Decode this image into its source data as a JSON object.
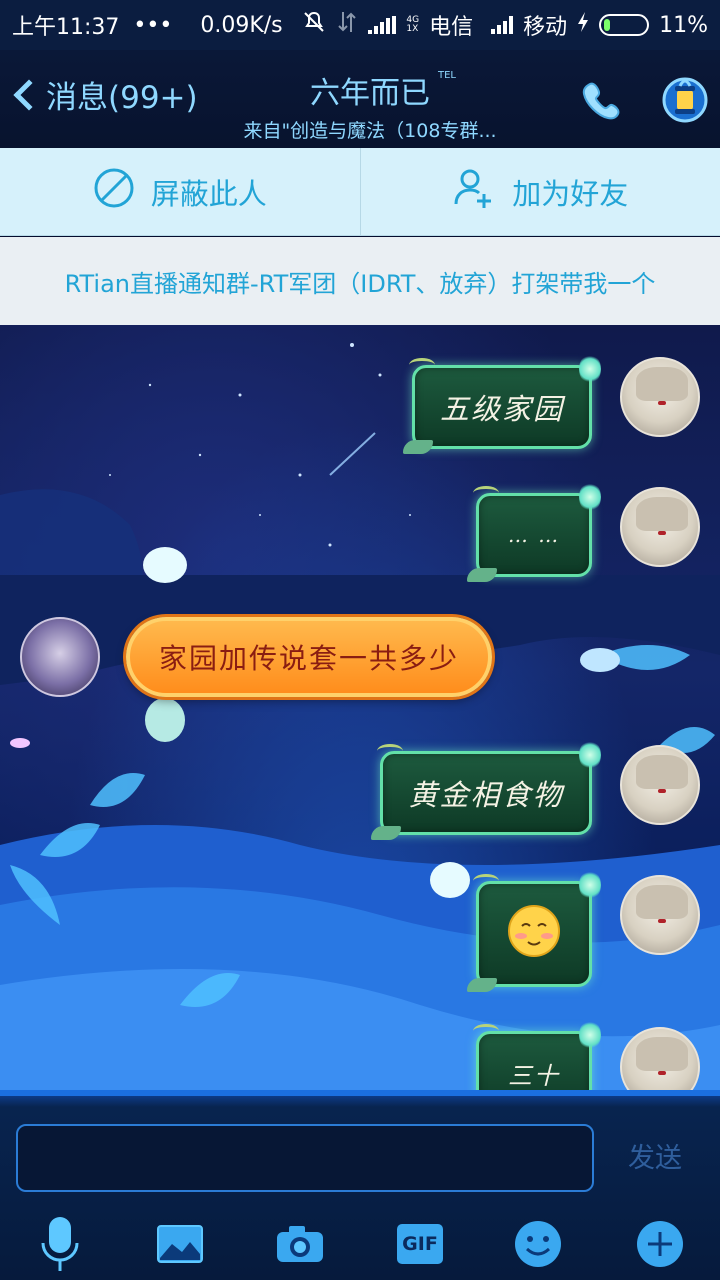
{
  "status_bar": {
    "time": "上午11:37",
    "dots": "•••",
    "net_speed": "0.09K/s",
    "carrier1": "电信",
    "carrier2": "移动",
    "net_4g": "4G",
    "net_1x": "1X",
    "battery": "11%"
  },
  "header": {
    "back_label": "消息(99+)",
    "title": "六年而已",
    "title_badge": "TEL",
    "subtitle": "来自\"创造与魔法（108专群..."
  },
  "actions": {
    "block_label": "屏蔽此人",
    "add_friend_label": "加为好友"
  },
  "banner": {
    "text": "RTian直播通知群-RT军团（IDRT、放弃）打架带我一个"
  },
  "messages": [
    {
      "side": "me",
      "text": "五级家园"
    },
    {
      "side": "me",
      "text": "… …"
    },
    {
      "side": "other",
      "text": "家园加传说套一共多少"
    },
    {
      "side": "me",
      "text": "黄金相食物"
    },
    {
      "side": "me",
      "text": "emoji:smile"
    },
    {
      "side": "me",
      "text": "三十"
    }
  ],
  "input": {
    "placeholder": "",
    "send_label": "发送"
  },
  "toolbar": {
    "items": [
      "mic-icon",
      "image-icon",
      "camera-icon",
      "gif-icon",
      "emoji-icon",
      "plus-icon"
    ],
    "gif_label": "GIF"
  },
  "colors": {
    "accent": "#22a4d6",
    "title_text": "#8fd8ff",
    "bubble_me_border": "#63e0a9",
    "bubble_other": "#ff9a2a"
  }
}
